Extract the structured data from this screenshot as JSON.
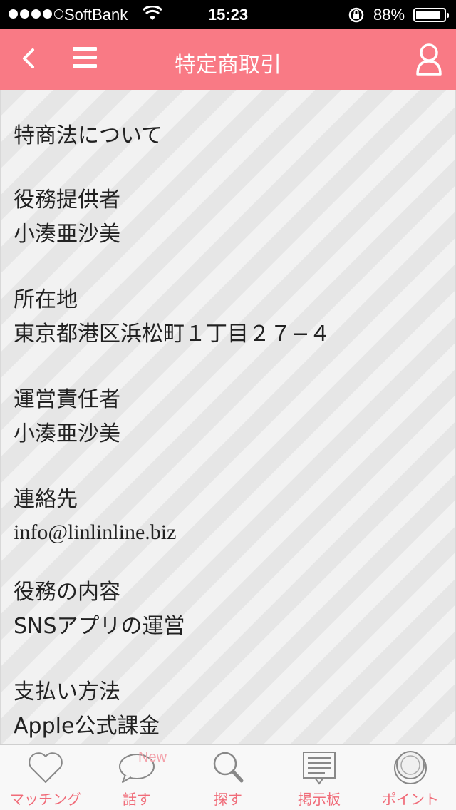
{
  "status_bar": {
    "carrier": "SoftBank",
    "time": "15:23",
    "battery_percent": "88%",
    "battery_level": 0.88
  },
  "nav": {
    "title": "特定商取引",
    "icons": [
      "back-chevron-icon",
      "hamburger-menu-icon",
      "user-icon"
    ]
  },
  "content": {
    "heading": "特商法について",
    "sections": [
      {
        "label": "役務提供者",
        "value": "小湊亜沙美"
      },
      {
        "label": "所在地",
        "value": "東京都港区浜松町１丁目２７−４"
      },
      {
        "label": "運営責任者",
        "value": "小湊亜沙美"
      },
      {
        "label": "連絡先",
        "value": "info@linlinline.biz"
      },
      {
        "label": "役務の内容",
        "value": "SNSアプリの運営"
      },
      {
        "label": "支払い方法",
        "value": "Apple公式課金"
      }
    ]
  },
  "tabs": [
    {
      "label": "マッチング",
      "icon": "heart-icon"
    },
    {
      "label": "話す",
      "icon": "speech-bubble-icon",
      "badge": "New"
    },
    {
      "label": "探す",
      "icon": "magnifier-icon"
    },
    {
      "label": "掲示板",
      "icon": "bulletin-board-icon"
    },
    {
      "label": "ポイント",
      "icon": "coin-icon"
    }
  ],
  "colors": {
    "accent": "#f97a85",
    "tab_label": "#f06b78",
    "badge": "#f4a1aa"
  }
}
